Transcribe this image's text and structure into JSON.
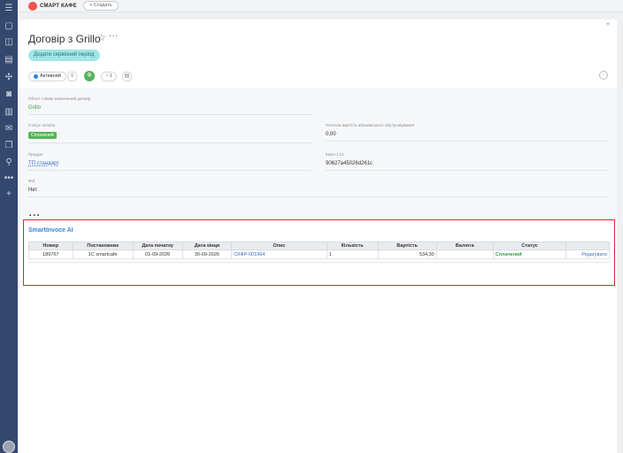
{
  "topbar": {
    "brand": "СМАРТ КАФЕ",
    "create_label": "+ Создать"
  },
  "card": {
    "close_glyph": "«",
    "title": "Договір з Grillo",
    "service_button": "Додати сервісний період",
    "status_active": "Активний",
    "status_count": "1",
    "green_circle_label": "Ф"
  },
  "fields": {
    "object": {
      "label": "Об'єкт з яким заключений договір",
      "value": "Grillo"
    },
    "payment_status": {
      "label": "Статус оплати",
      "value": "Сплачений"
    },
    "current_cost": {
      "label": "Поточна вартість абонемського обслуговування",
      "value": "0,00"
    },
    "product": {
      "label": "Продукт",
      "value": "ТП стандарт"
    },
    "key_1c": {
      "label": "Ключ з 1С",
      "value": "90627a45026d261c"
    },
    "fiz": {
      "label": "ФІЗ",
      "value": "Нет"
    },
    "more": "..."
  },
  "smart_invoice": {
    "title": "SmartInvoce AI",
    "columns": [
      "Номер",
      "Постановник",
      "Дата початку",
      "Дата кінця",
      "Опис",
      "Кількість",
      "Вартість",
      "Валюта",
      "Статус",
      ""
    ],
    "rows": [
      {
        "number": "189767",
        "provider": "1С smartcafe",
        "start": "01-09-2026",
        "end": "30-09-2026",
        "desc": "СКФР-001964",
        "qty": "1",
        "cost": "534,30",
        "currency": "",
        "status": "Сплачений",
        "action": "Редагувати"
      }
    ]
  },
  "colors": {
    "rail": "#34486d",
    "accent_red": "#d9282f",
    "paid_green": "#55b35d",
    "link_blue": "#3b6fc2",
    "service_button": "#9ee7e6"
  }
}
